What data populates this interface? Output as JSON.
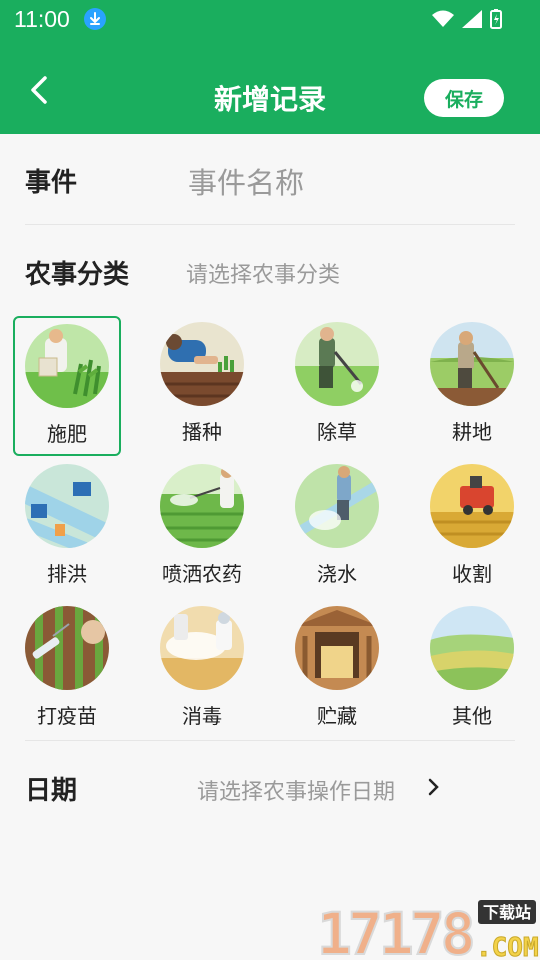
{
  "status_bar": {
    "time": "11:00",
    "icons": [
      "download-icon",
      "wifi-icon",
      "signal-icon",
      "battery-icon"
    ]
  },
  "app_bar": {
    "title": "新增记录",
    "save_label": "保存",
    "back_icon": "chevron-left-icon"
  },
  "event": {
    "label": "事件",
    "placeholder": "事件名称"
  },
  "category": {
    "label": "农事分类",
    "placeholder": "请选择农事分类",
    "selected": "施肥",
    "items": [
      {
        "label": "施肥"
      },
      {
        "label": "播种"
      },
      {
        "label": "除草"
      },
      {
        "label": "耕地"
      },
      {
        "label": "排洪"
      },
      {
        "label": "喷洒农药"
      },
      {
        "label": "浇水"
      },
      {
        "label": "收割"
      },
      {
        "label": "打疫苗"
      },
      {
        "label": "消毒"
      },
      {
        "label": "贮藏"
      },
      {
        "label": "其他"
      }
    ]
  },
  "date": {
    "label": "日期",
    "placeholder": "请选择农事操作日期"
  },
  "watermark": {
    "text": "17178",
    "badge": "下载站",
    "suffix": ".COM"
  },
  "colors": {
    "primary": "#1aae5e",
    "hint": "#9a9a9a"
  }
}
